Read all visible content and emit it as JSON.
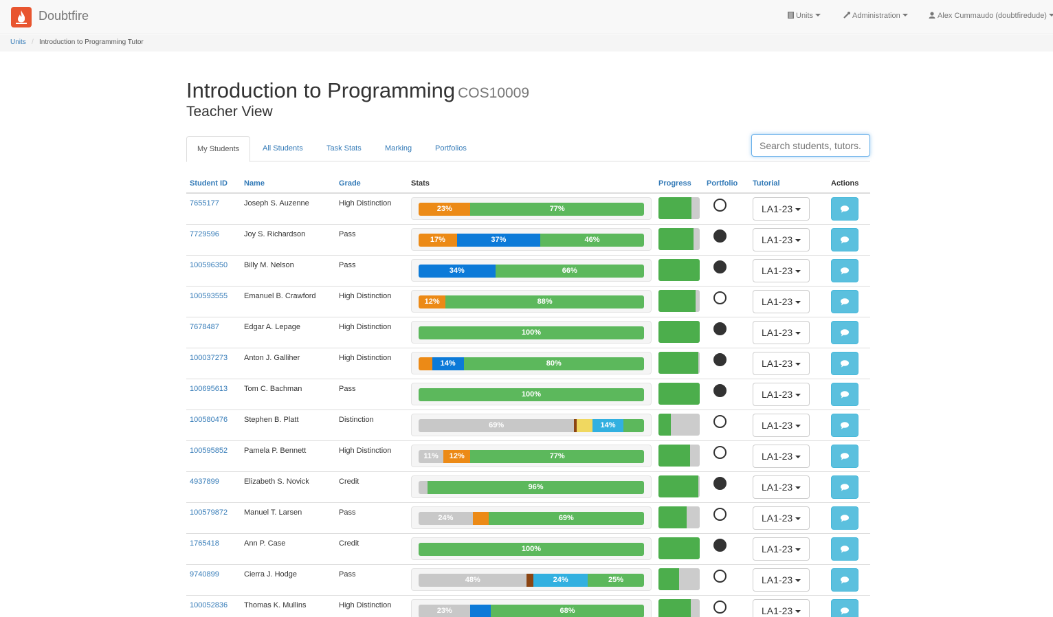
{
  "brand": {
    "name": "Doubtfire"
  },
  "nav": {
    "units": "Units",
    "administration": "Administration",
    "user": "Alex Cummaudo (doubtfiredude)"
  },
  "breadcrumb": {
    "root": "Units",
    "separator": "/",
    "current": "Introduction to Programming Tutor"
  },
  "header": {
    "title": "Introduction to Programming",
    "code": "COS10009",
    "subtitle": "Teacher View"
  },
  "tabs": [
    "My Students",
    "All Students",
    "Task Stats",
    "Marking",
    "Portfolios"
  ],
  "search": {
    "placeholder": "Search students, tutors..."
  },
  "columns": {
    "student_id": "Student ID",
    "name": "Name",
    "grade": "Grade",
    "stats": "Stats",
    "progress": "Progress",
    "portfolio": "Portfolio",
    "tutorial": "Tutorial",
    "actions": "Actions"
  },
  "colors": {
    "orange": "#ec8a16",
    "blue": "#0c7ad8",
    "green": "#5cb85c",
    "grey": "#c8c8c8",
    "yellow": "#f0d860",
    "brown": "#8b4513",
    "lightblue": "#32b0e0",
    "accent": "#337ab7"
  },
  "students": [
    {
      "id": "7655177",
      "name": "Joseph S. Auzenne",
      "grade": "High Distinction",
      "progress": 80,
      "portfolio": false,
      "tutorial": "LA1-23",
      "stats": [
        {
          "c": "orange",
          "v": 23,
          "label": "23%"
        },
        {
          "c": "green",
          "v": 77,
          "label": "77%"
        }
      ]
    },
    {
      "id": "7729596",
      "name": "Joy S. Richardson",
      "grade": "Pass",
      "progress": 85,
      "portfolio": true,
      "tutorial": "LA1-23",
      "stats": [
        {
          "c": "orange",
          "v": 17,
          "label": "17%"
        },
        {
          "c": "blue",
          "v": 37,
          "label": "37%"
        },
        {
          "c": "green",
          "v": 46,
          "label": "46%"
        }
      ]
    },
    {
      "id": "100596350",
      "name": "Billy M. Nelson",
      "grade": "Pass",
      "progress": 100,
      "portfolio": true,
      "tutorial": "LA1-23",
      "stats": [
        {
          "c": "blue",
          "v": 34,
          "label": "34%"
        },
        {
          "c": "green",
          "v": 66,
          "label": "66%"
        }
      ]
    },
    {
      "id": "100593555",
      "name": "Emanuel B. Crawford",
      "grade": "High Distinction",
      "progress": 90,
      "portfolio": false,
      "tutorial": "LA1-23",
      "stats": [
        {
          "c": "orange",
          "v": 12,
          "label": "12%"
        },
        {
          "c": "green",
          "v": 88,
          "label": "88%"
        }
      ]
    },
    {
      "id": "7678487",
      "name": "Edgar A. Lepage",
      "grade": "High Distinction",
      "progress": 100,
      "portfolio": true,
      "tutorial": "LA1-23",
      "stats": [
        {
          "c": "green",
          "v": 100,
          "label": "100%"
        }
      ]
    },
    {
      "id": "100037273",
      "name": "Anton J. Galliher",
      "grade": "High Distinction",
      "progress": 97,
      "portfolio": true,
      "tutorial": "LA1-23",
      "stats": [
        {
          "c": "orange",
          "v": 6,
          "label": ""
        },
        {
          "c": "blue",
          "v": 14,
          "label": "14%"
        },
        {
          "c": "green",
          "v": 80,
          "label": "80%"
        }
      ]
    },
    {
      "id": "100695613",
      "name": "Tom C. Bachman",
      "grade": "Pass",
      "progress": 100,
      "portfolio": true,
      "tutorial": "LA1-23",
      "stats": [
        {
          "c": "green",
          "v": 100,
          "label": "100%"
        }
      ]
    },
    {
      "id": "100580476",
      "name": "Stephen B. Platt",
      "grade": "Distinction",
      "progress": 30,
      "portfolio": false,
      "tutorial": "LA1-23",
      "stats": [
        {
          "c": "grey",
          "v": 69,
          "label": "69%"
        },
        {
          "c": "brown",
          "v": 1,
          "label": ""
        },
        {
          "c": "yellow",
          "v": 7,
          "label": ""
        },
        {
          "c": "lightblue",
          "v": 14,
          "label": "14%"
        },
        {
          "c": "green",
          "v": 9,
          "label": ""
        }
      ]
    },
    {
      "id": "100595852",
      "name": "Pamela P. Bennett",
      "grade": "High Distinction",
      "progress": 77,
      "portfolio": false,
      "tutorial": "LA1-23",
      "stats": [
        {
          "c": "grey",
          "v": 11,
          "label": "11%"
        },
        {
          "c": "orange",
          "v": 12,
          "label": "12%"
        },
        {
          "c": "green",
          "v": 77,
          "label": "77%"
        }
      ]
    },
    {
      "id": "4937899",
      "name": "Elizabeth S. Novick",
      "grade": "Credit",
      "progress": 96,
      "portfolio": true,
      "tutorial": "LA1-23",
      "stats": [
        {
          "c": "grey",
          "v": 4,
          "label": ""
        },
        {
          "c": "green",
          "v": 96,
          "label": "96%"
        }
      ]
    },
    {
      "id": "100579872",
      "name": "Manuel T. Larsen",
      "grade": "Pass",
      "progress": 69,
      "portfolio": false,
      "tutorial": "LA1-23",
      "stats": [
        {
          "c": "grey",
          "v": 24,
          "label": "24%"
        },
        {
          "c": "orange",
          "v": 7,
          "label": ""
        },
        {
          "c": "green",
          "v": 69,
          "label": "69%"
        }
      ]
    },
    {
      "id": "1765418",
      "name": "Ann P. Case",
      "grade": "Credit",
      "progress": 100,
      "portfolio": true,
      "tutorial": "LA1-23",
      "stats": [
        {
          "c": "green",
          "v": 100,
          "label": "100%"
        }
      ]
    },
    {
      "id": "9740899",
      "name": "Cierra J. Hodge",
      "grade": "Pass",
      "progress": 50,
      "portfolio": false,
      "tutorial": "LA1-23",
      "stats": [
        {
          "c": "grey",
          "v": 48,
          "label": "48%"
        },
        {
          "c": "brown",
          "v": 3,
          "label": ""
        },
        {
          "c": "lightblue",
          "v": 24,
          "label": "24%"
        },
        {
          "c": "green",
          "v": 25,
          "label": "25%"
        }
      ]
    },
    {
      "id": "100052836",
      "name": "Thomas K. Mullins",
      "grade": "High Distinction",
      "progress": 78,
      "portfolio": false,
      "tutorial": "LA1-23",
      "stats": [
        {
          "c": "grey",
          "v": 23,
          "label": "23%"
        },
        {
          "c": "blue",
          "v": 9,
          "label": ""
        },
        {
          "c": "green",
          "v": 68,
          "label": "68%"
        }
      ]
    }
  ]
}
